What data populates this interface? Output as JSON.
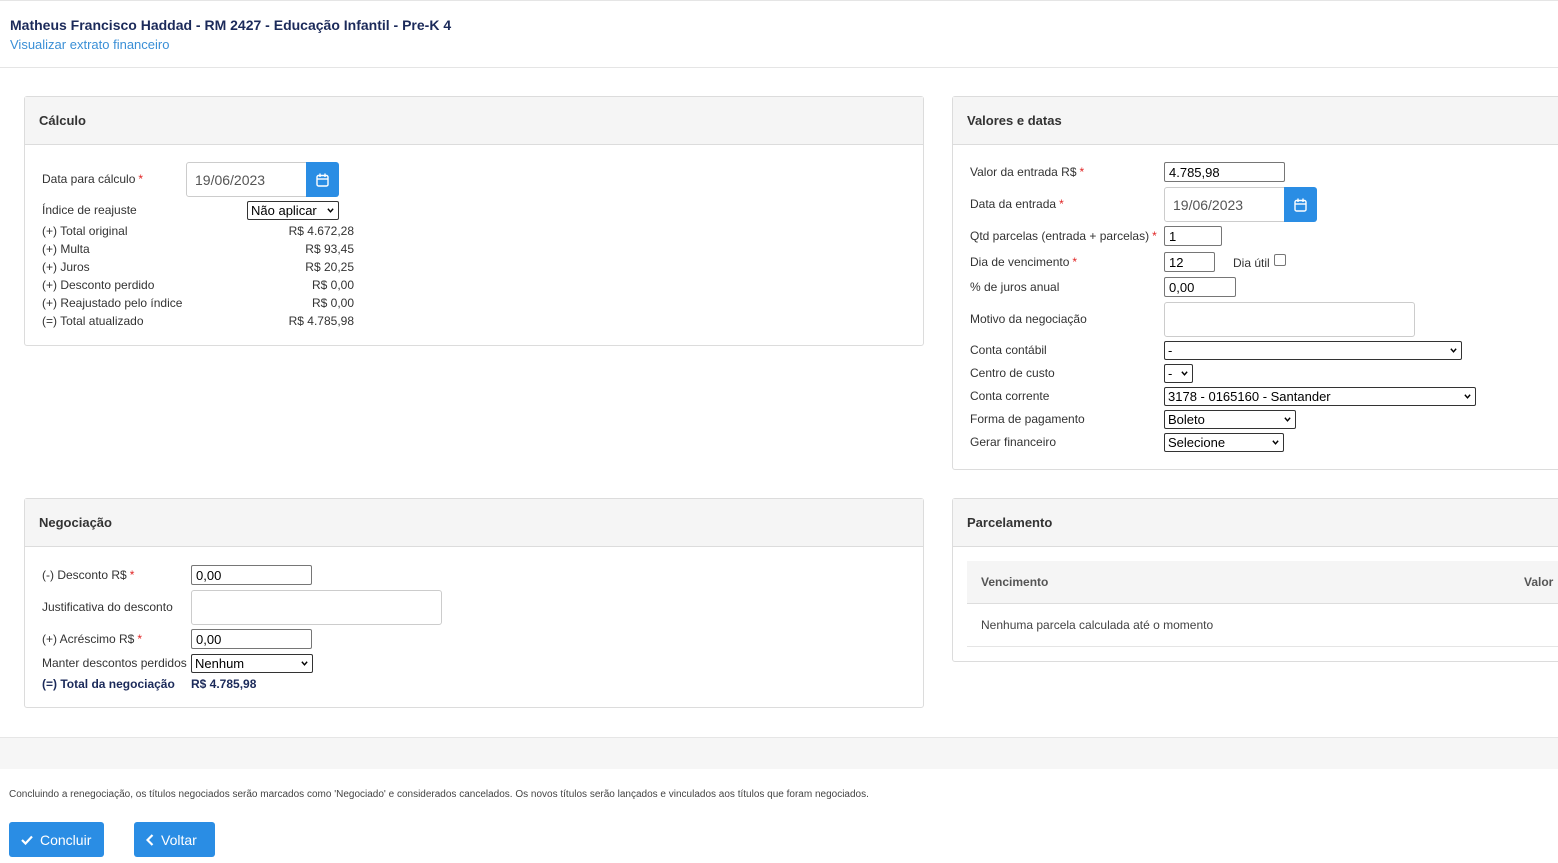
{
  "header": {
    "title": "Matheus Francisco Haddad - RM 2427 - Educação Infantil - Pre-K 4",
    "link": "Visualizar extrato financeiro"
  },
  "calculo": {
    "title": "Cálculo",
    "data_label": "Data para cálculo",
    "data_value": "19/06/2023",
    "indice_label": "Índice de reajuste",
    "indice_value": "Não aplicar",
    "rows": [
      {
        "label": "(+) Total original",
        "value": "R$ 4.672,28"
      },
      {
        "label": "(+) Multa",
        "value": "R$ 93,45"
      },
      {
        "label": "(+) Juros",
        "value": "R$ 20,25"
      },
      {
        "label": "(+) Desconto perdido",
        "value": "R$ 0,00"
      },
      {
        "label": "(+) Reajustado pelo índice",
        "value": "R$ 0,00"
      },
      {
        "label": "(=) Total atualizado",
        "value": "R$ 4.785,98"
      }
    ]
  },
  "valores": {
    "title": "Valores e datas",
    "entrada_label": "Valor da entrada R$",
    "entrada_value": "4.785,98",
    "data_entrada_label": "Data da entrada",
    "data_entrada_value": "19/06/2023",
    "qtd_label": "Qtd parcelas (entrada + parcelas)",
    "qtd_value": "1",
    "dia_label": "Dia de vencimento",
    "dia_value": "12",
    "dia_util_label": "Dia útil",
    "juros_label": "% de juros anual",
    "juros_value": "0,00",
    "motivo_label": "Motivo da negociação",
    "conta_contabil_label": "Conta contábil",
    "conta_contabil_value": "-",
    "centro_label": "Centro de custo",
    "centro_value": "-",
    "conta_corrente_label": "Conta corrente",
    "conta_corrente_value": "3178 - 0165160 - Santander",
    "forma_label": "Forma de pagamento",
    "forma_value": "Boleto",
    "gerar_label": "Gerar financeiro",
    "gerar_value": "Selecione"
  },
  "negociacao": {
    "title": "Negociação",
    "desconto_label": "(-) Desconto R$",
    "desconto_value": "0,00",
    "justificativa_label": "Justificativa do desconto",
    "acrescimo_label": "(+) Acréscimo R$",
    "acrescimo_value": "0,00",
    "manter_label": "Manter descontos perdidos",
    "manter_value": "Nenhum",
    "total_label": "(=) Total da negociação",
    "total_value": "R$ 4.785,98"
  },
  "parcelamento": {
    "title": "Parcelamento",
    "col_vencimento": "Vencimento",
    "col_valor": "Valor",
    "empty": "Nenhuma parcela calculada até o momento"
  },
  "footer": {
    "note": "Concluindo a renegociação, os títulos negociados serão marcados como 'Negociado' e considerados cancelados. Os novos títulos serão lançados e vinculados aos títulos que foram negociados.",
    "concluir": "Concluir",
    "voltar": "Voltar"
  },
  "colors": {
    "primary": "#2a8de4",
    "title": "#1b2a5a",
    "link": "#3a8fd6",
    "required": "#e02424"
  }
}
